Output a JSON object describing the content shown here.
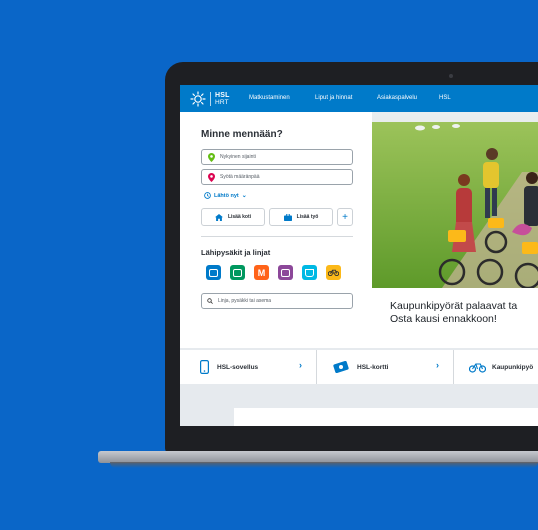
{
  "nav": {
    "logo_line1": "HSL",
    "logo_line2": "HRT",
    "items": [
      "Matkustaminen",
      "Liput ja hinnat",
      "Asiakaspalvelu",
      "HSL"
    ]
  },
  "journey": {
    "title": "Minne mennään?",
    "origin_placeholder": "Nykyinen sijainti",
    "destination_placeholder": "Syötä määränpää",
    "time_label": "Lähtö nyt",
    "add_home": "Lisää koti",
    "add_work": "Lisää työ",
    "add_more": "+"
  },
  "nearby": {
    "title": "Lähipysäkit ja linjat",
    "modes": [
      {
        "icon": "bus-icon",
        "color": "#007ac9"
      },
      {
        "icon": "tram-icon",
        "color": "#00985f"
      },
      {
        "icon": "metro-icon",
        "color": "#ff6319"
      },
      {
        "icon": "train-icon",
        "color": "#8c4799"
      },
      {
        "icon": "ferry-icon",
        "color": "#00b9e4"
      },
      {
        "icon": "bike-icon",
        "color": "#fcb919"
      }
    ],
    "search_placeholder": "Linja, pysäkki tai asema"
  },
  "hero": {
    "caption_line1": "Kaupunkipyörät palaavat ta",
    "caption_line2": "Osta kausi ennakkoon!"
  },
  "services": [
    {
      "icon": "phone-icon",
      "label": "HSL-sovellus",
      "chevron": "›"
    },
    {
      "icon": "card-icon",
      "label": "HSL-kortti",
      "chevron": "›"
    },
    {
      "icon": "bike-icon",
      "label": "Kaupunkipyö",
      "chevron": ""
    }
  ],
  "colors": {
    "background": "#0a66c8",
    "brand": "#007ac9"
  }
}
